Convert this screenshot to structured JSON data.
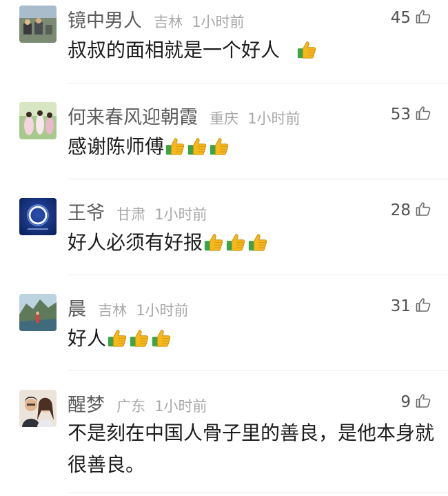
{
  "comments": [
    {
      "username": "镜中男人",
      "location": "吉林",
      "time": "1小时前",
      "likes": "45",
      "text": "叔叔的面相就是一个好人 ",
      "thumbs": 1
    },
    {
      "username": "何来春风迎朝霞",
      "location": "重庆",
      "time": "1小时前",
      "likes": "53",
      "text": "感谢陈师傅",
      "thumbs": 3
    },
    {
      "username": "王爷",
      "location": "甘肃",
      "time": "1小时前",
      "likes": "28",
      "text": "好人必须有好报",
      "thumbs": 3
    },
    {
      "username": "晨",
      "location": "吉林",
      "time": "1小时前",
      "likes": "31",
      "text": "好人",
      "thumbs": 3
    },
    {
      "username": "醒梦",
      "location": "广东",
      "time": "1小时前",
      "likes": "9",
      "text": "不是刻在中国人骨子里的善良，是他本身就很善良。",
      "thumbs": 0
    }
  ],
  "colors": {
    "username": "#5b5b5b",
    "meta": "#a8a8a8",
    "text": "#1c1c1c",
    "thumb_yellow": "#f6b81c",
    "thumb_green": "#3aa64b",
    "divider": "#ececec"
  },
  "icons": {
    "like": "thumbs-up-outline-icon",
    "emoji": "thumbs-up-emoji-icon"
  }
}
